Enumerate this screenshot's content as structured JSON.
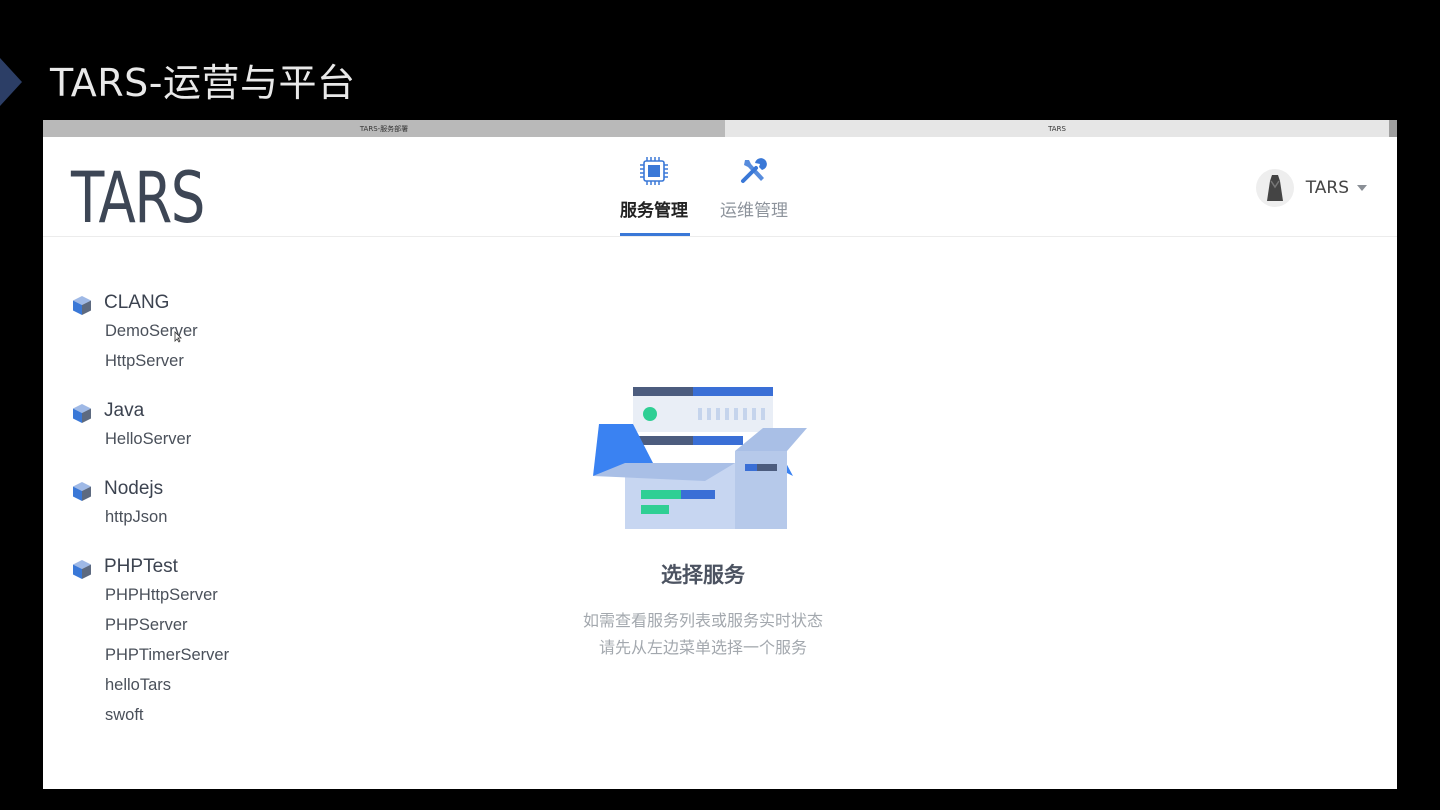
{
  "slide": {
    "title": "TARS-运营与平台"
  },
  "browser": {
    "tabs": [
      {
        "label": "TARS-服务部署"
      },
      {
        "label": "TARS"
      }
    ]
  },
  "header": {
    "logo": "TARS",
    "nav": [
      {
        "label": "服务管理",
        "icon": "chip-icon",
        "active": true
      },
      {
        "label": "运维管理",
        "icon": "wrench-screwdriver-icon",
        "active": false
      }
    ],
    "user": {
      "name": "TARS"
    }
  },
  "sidebar": {
    "groups": [
      {
        "name": "CLANG",
        "servers": [
          "DemoServer",
          "HttpServer"
        ]
      },
      {
        "name": "Java",
        "servers": [
          "HelloServer"
        ]
      },
      {
        "name": "Nodejs",
        "servers": [
          "httpJson"
        ]
      },
      {
        "name": "PHPTest",
        "servers": [
          "PHPHttpServer",
          "PHPServer",
          "PHPTimerServer",
          "helloTars",
          "swoft"
        ]
      }
    ]
  },
  "main": {
    "empty_title": "选择服务",
    "empty_desc_line1": "如需查看服务列表或服务实时状态",
    "empty_desc_line2": "请先从左边菜单选择一个服务"
  },
  "colors": {
    "accent": "#3a78d7",
    "page_background": "#000000",
    "card_background": "#ffffff",
    "title_text": "#e9e9e9"
  }
}
